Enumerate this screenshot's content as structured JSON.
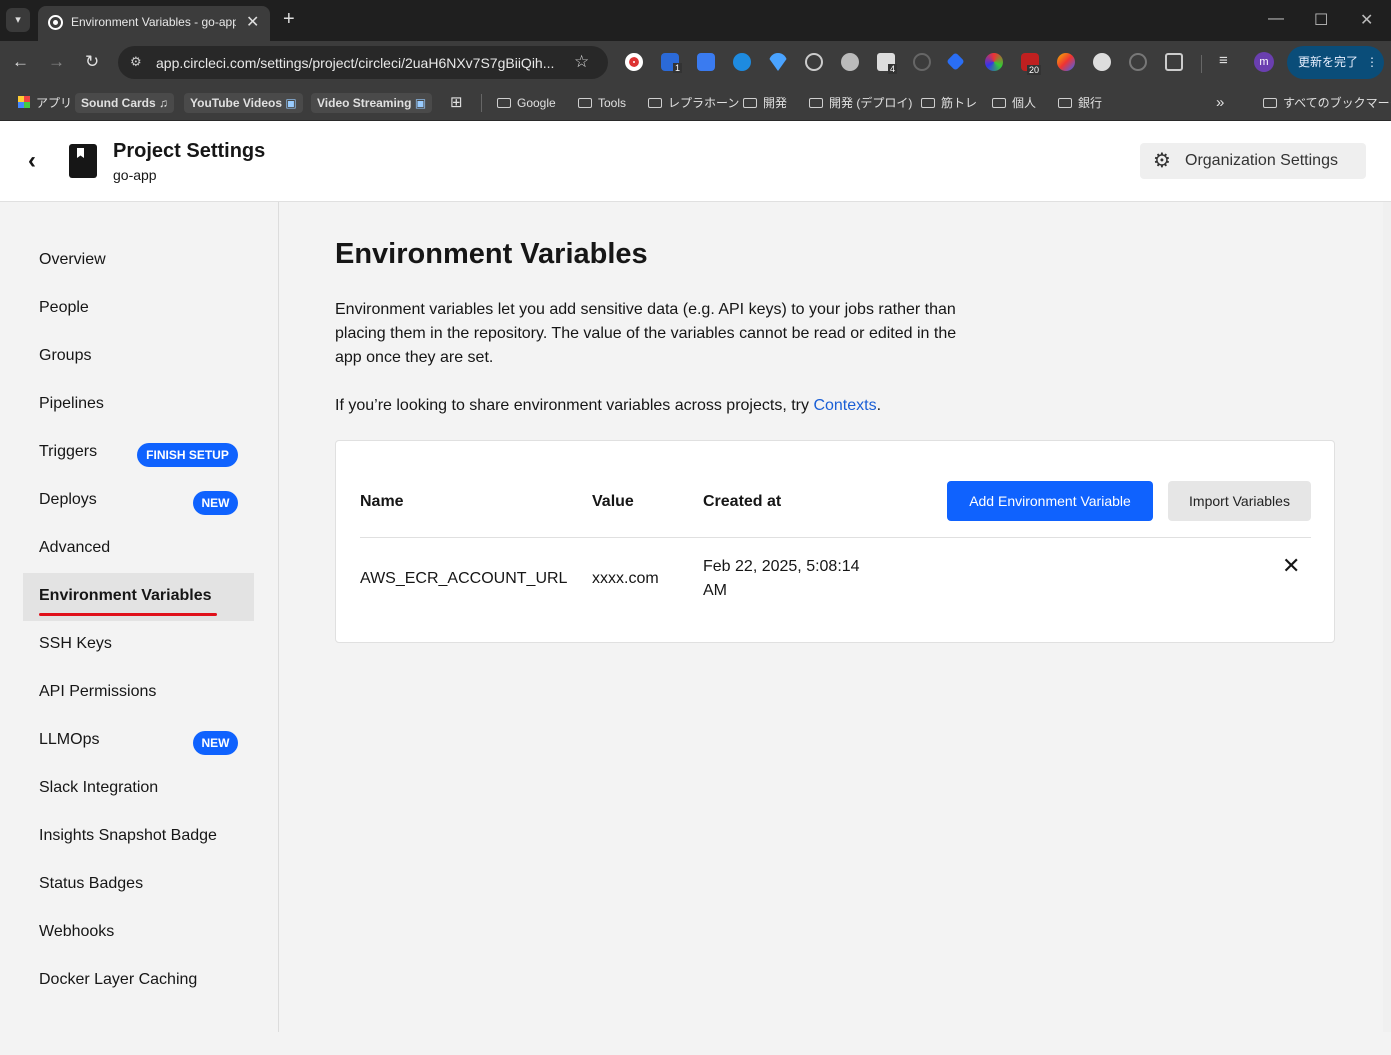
{
  "browser": {
    "tab_title": "Environment Variables - go-app",
    "new_tab": "+",
    "url": "app.circleci.com/settings/project/circleci/2uaH6NXv7S7gBiiQih...",
    "profile_initial": "m",
    "update_button": "更新を完了",
    "bookmarks": [
      {
        "label": "アプリ"
      },
      {
        "label": "Sound Cards"
      },
      {
        "label": "YouTube Videos"
      },
      {
        "label": "Video Streaming"
      },
      {
        "label": "Google"
      },
      {
        "label": "Tools"
      },
      {
        "label": "レプラホーン"
      },
      {
        "label": "開発"
      },
      {
        "label": "開発 (デプロイ)"
      },
      {
        "label": "筋トレ"
      },
      {
        "label": "個人"
      },
      {
        "label": "銀行"
      }
    ],
    "more_bookmarks": "»",
    "all_bookmarks": "すべてのブックマーク",
    "extension_badges": {
      "ext_1": "1",
      "ext_4": "4",
      "ext_20": "20"
    }
  },
  "header": {
    "title": "Project Settings",
    "project_name": "go-app",
    "org_settings_label": "Organization Settings"
  },
  "sidebar": {
    "items": [
      {
        "label": "Overview"
      },
      {
        "label": "People"
      },
      {
        "label": "Groups"
      },
      {
        "label": "Pipelines"
      },
      {
        "label": "Triggers",
        "badge": "FINISH SETUP"
      },
      {
        "label": "Deploys",
        "badge": "NEW"
      },
      {
        "label": "Advanced"
      },
      {
        "label": "Environment Variables",
        "active": true
      },
      {
        "label": "SSH Keys"
      },
      {
        "label": "API Permissions"
      },
      {
        "label": "LLMOps",
        "badge": "NEW"
      },
      {
        "label": "Slack Integration"
      },
      {
        "label": "Insights Snapshot Badge"
      },
      {
        "label": "Status Badges"
      },
      {
        "label": "Webhooks"
      },
      {
        "label": "Docker Layer Caching"
      }
    ]
  },
  "main": {
    "title": "Environment Variables",
    "description": "Environment variables let you add sensitive data (e.g. API keys) to your jobs rather than placing them in the repository. The value of the variables cannot be read or edited in the app once they are set.",
    "share_prefix": "If you’re looking to share environment variables across projects, try ",
    "share_link": "Contexts",
    "share_suffix": ".",
    "table": {
      "headers": {
        "name": "Name",
        "value": "Value",
        "created": "Created at"
      },
      "rows": [
        {
          "name": "AWS_ECR_ACCOUNT_URL",
          "value": "xxxx.com",
          "created_line1": "Feb 22, 2025, 5:08:14",
          "created_line2": "AM"
        }
      ]
    },
    "add_button": "Add Environment Variable",
    "import_button": "Import Variables"
  },
  "colors": {
    "accent_blue": "#0f62fe",
    "link_blue": "#1a5fd6",
    "active_underline": "#e0101a"
  }
}
